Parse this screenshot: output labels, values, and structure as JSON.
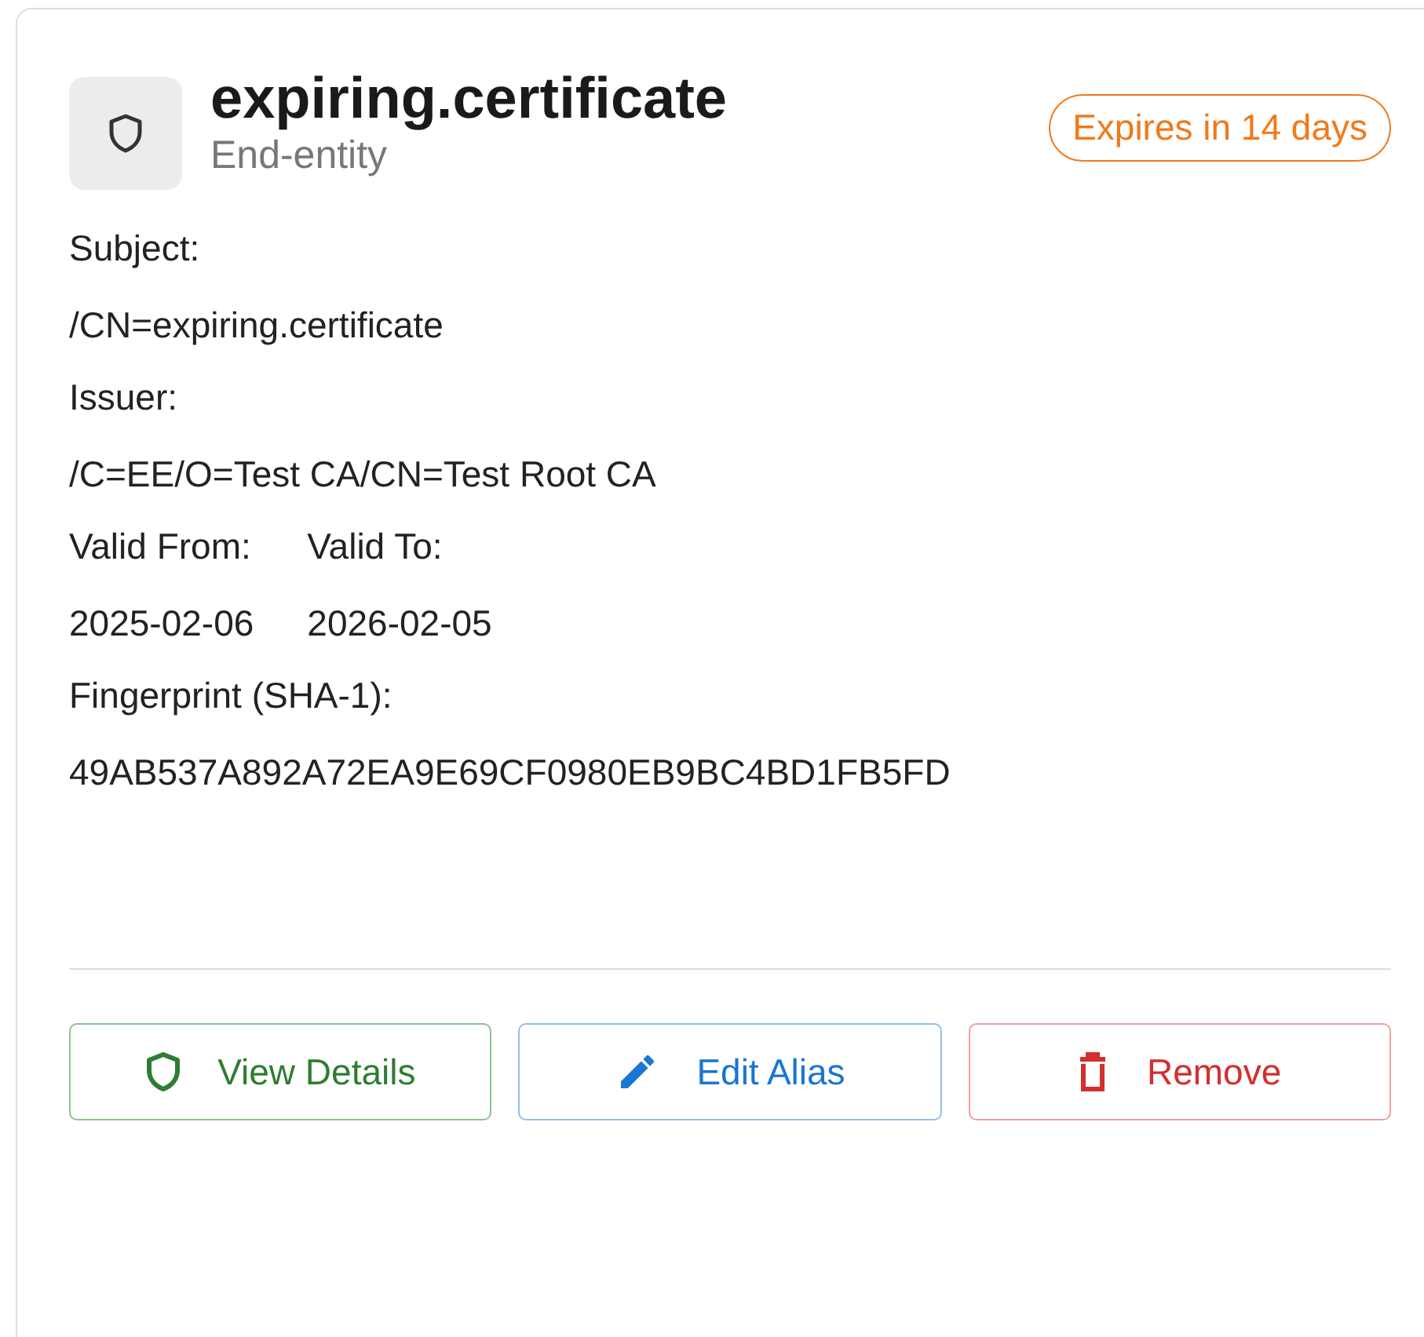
{
  "certificate": {
    "title": "expiring.certificate",
    "subtitle": "End-entity",
    "badge": "Expires in 14 days"
  },
  "fields": [
    {
      "label": "Subject:",
      "value": "/CN=expiring.certificate"
    },
    {
      "label": "Issuer:",
      "value": "/C=EE/O=Test CA/CN=Test Root CA"
    }
  ],
  "validity": [
    {
      "label": "Valid From:",
      "value": "2025-02-06"
    },
    {
      "label": "Valid To:",
      "value": "2026-02-05"
    }
  ],
  "fingerprint": {
    "label": "Fingerprint (SHA-1):",
    "value": "49AB537A892A72EA9E69CF0980EB9BC4BD1FB5FD"
  },
  "buttons": [
    {
      "label": "View Details",
      "kind": "view"
    },
    {
      "label": "Edit Alias",
      "kind": "edit"
    },
    {
      "label": "Remove",
      "kind": "remove"
    }
  ]
}
